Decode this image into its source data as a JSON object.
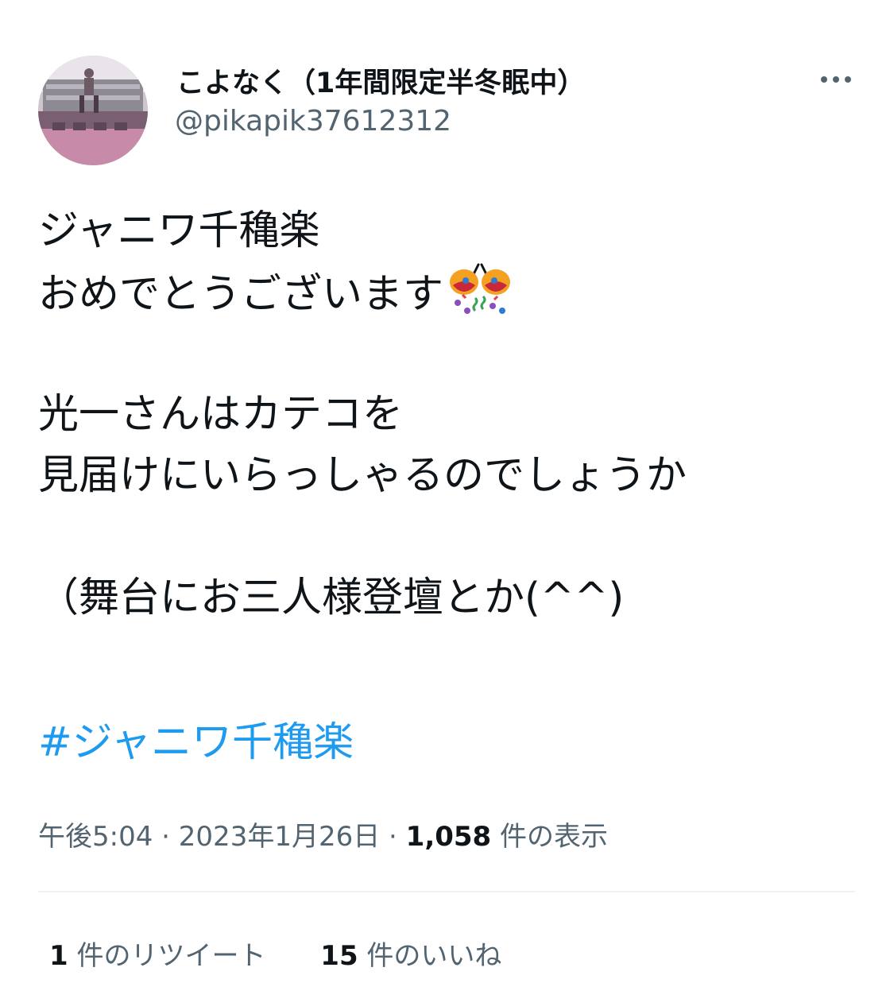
{
  "header": {
    "display_name": "こよなく（1年間限定半冬眠中）",
    "handle": "@pikapik37612312"
  },
  "tweet": {
    "lines": [
      "ジャニワ千穐楽",
      "おめでとうございます",
      "",
      "光一さんはカテコを",
      "見届けにいらっしゃるのでしょうか",
      "",
      "（舞台にお三人様登壇とか(^^)"
    ],
    "emoji": "party-popper-icon",
    "hashtag": "#ジャニワ千穐楽"
  },
  "meta": {
    "time": "午後5:04",
    "separator": " · ",
    "date": "2023年1月26日",
    "views_count": "1,058",
    "views_label": " 件の表示"
  },
  "stats": {
    "retweets_count": "1",
    "retweets_label": " 件のリツイート",
    "likes_count": "15",
    "likes_label": " 件のいいね"
  },
  "colors": {
    "text": "#0f1419",
    "secondary": "#536471",
    "link": "#1d9bf0",
    "divider": "#eff3f4"
  }
}
